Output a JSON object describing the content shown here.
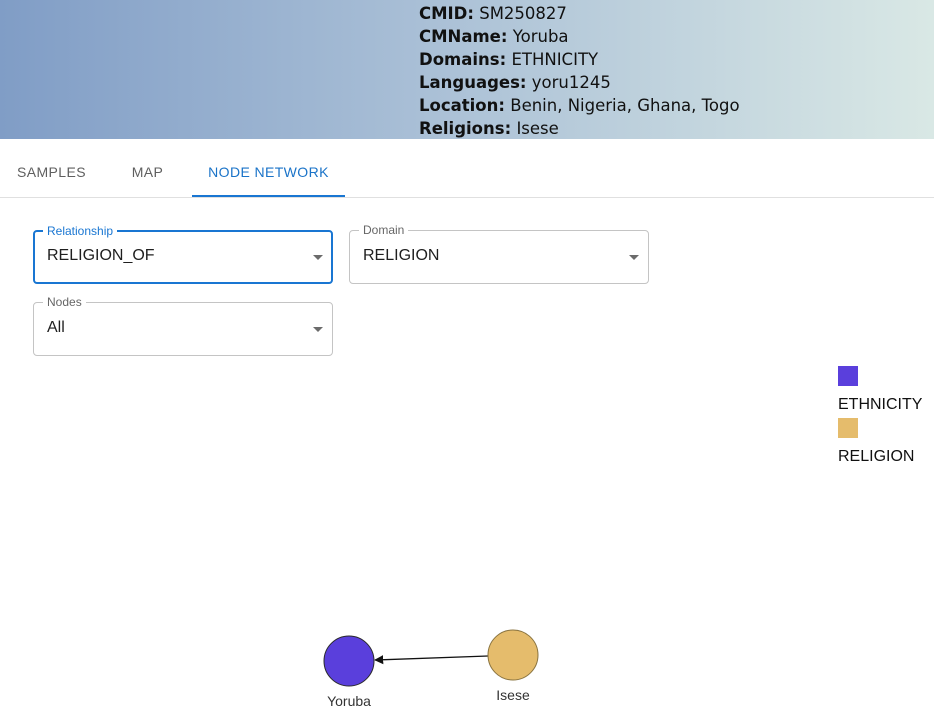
{
  "header": {
    "cmid": {
      "label": "CMID:",
      "value": "SM250827"
    },
    "cmname": {
      "label": "CMName:",
      "value": "Yoruba"
    },
    "domains": {
      "label": "Domains:",
      "value": "ETHNICITY"
    },
    "languages": {
      "label": "Languages:",
      "value": "yoru1245"
    },
    "location": {
      "label": "Location:",
      "value": "Benin, Nigeria, Ghana, Togo"
    },
    "religions": {
      "label": "Religions:",
      "value": "Isese"
    }
  },
  "tabs": [
    {
      "label": "SAMPLES",
      "active": false
    },
    {
      "label": "MAP",
      "active": false
    },
    {
      "label": "NODE NETWORK",
      "active": true
    }
  ],
  "filters": {
    "relationship": {
      "label": "Relationship",
      "value": "RELIGION_OF"
    },
    "domain": {
      "label": "Domain",
      "value": "RELIGION"
    },
    "nodes": {
      "label": "Nodes",
      "value": "All"
    }
  },
  "legend": [
    {
      "label": "ETHNICITY",
      "color": "#5a3fdc"
    },
    {
      "label": "RELIGION",
      "color": "#e5bc6c"
    }
  ],
  "network": {
    "nodes": [
      {
        "id": "yoruba",
        "label": "Yoruba",
        "domain": "ETHNICITY"
      },
      {
        "id": "isese",
        "label": "Isese",
        "domain": "RELIGION"
      }
    ],
    "edges": [
      {
        "from": "isese",
        "to": "yoruba",
        "relationship": "RELIGION_OF"
      }
    ]
  },
  "colors": {
    "accent": "#1976d2",
    "ethnicity": "#5a3fdc",
    "religion": "#e5bc6c"
  }
}
